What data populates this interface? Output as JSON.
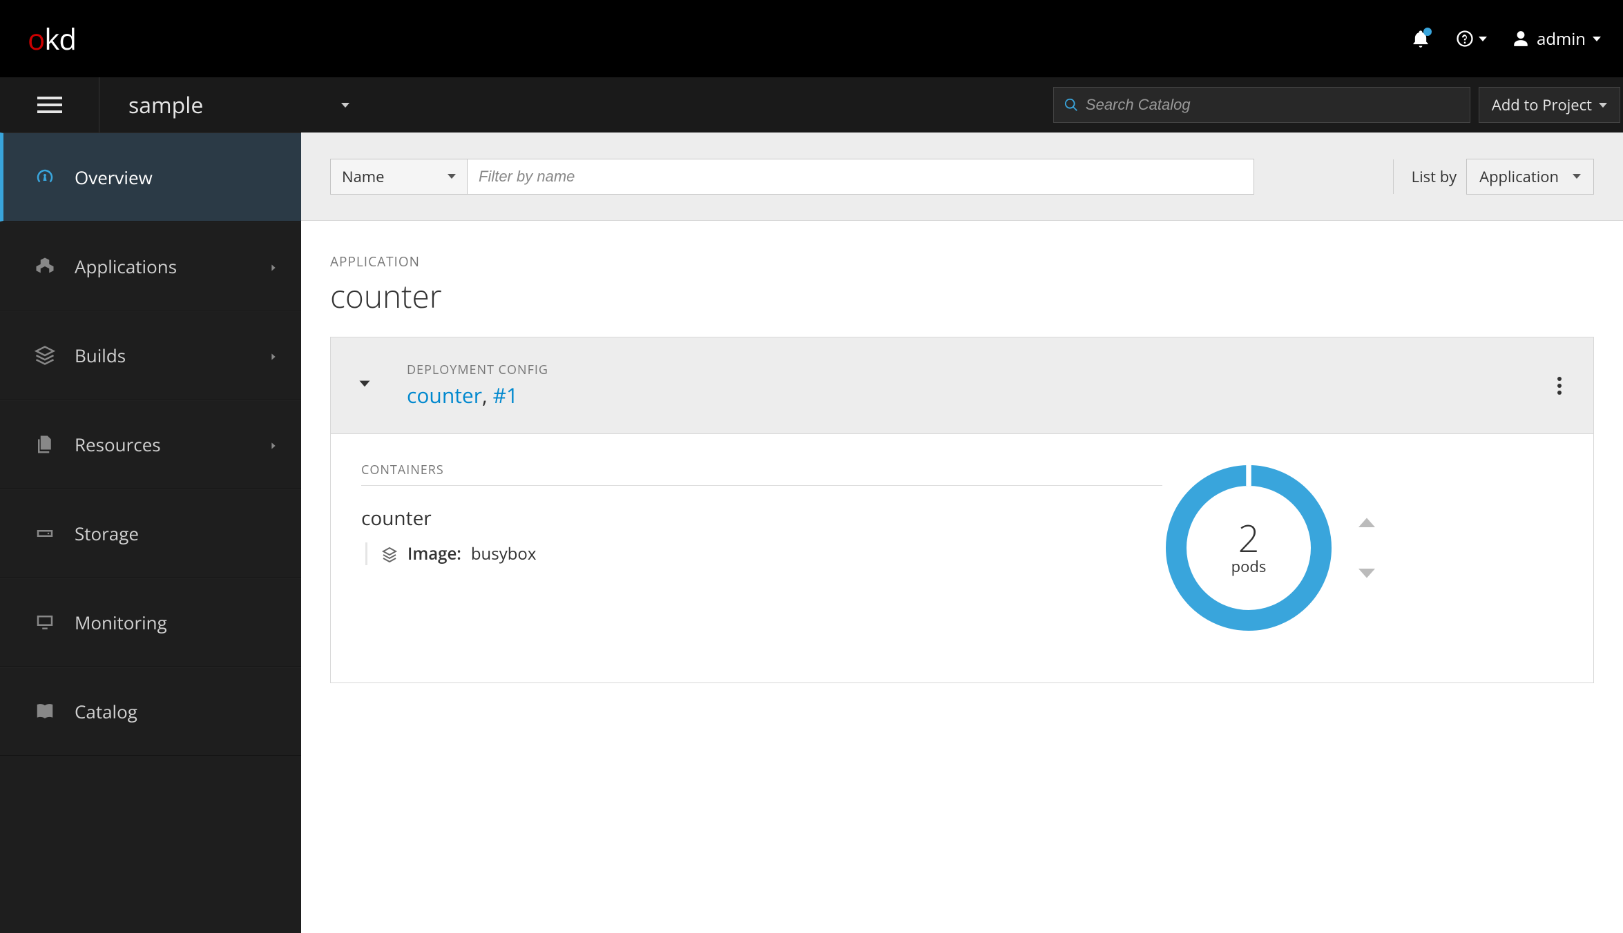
{
  "header": {
    "logo": {
      "o": "o",
      "kd": "kd"
    },
    "username": "admin"
  },
  "project_bar": {
    "project_name": "sample",
    "search_placeholder": "Search Catalog",
    "add_to_project": "Add to Project"
  },
  "sidebar": {
    "items": {
      "overview": "Overview",
      "applications": "Applications",
      "builds": "Builds",
      "resources": "Resources",
      "storage": "Storage",
      "monitoring": "Monitoring",
      "catalog": "Catalog"
    }
  },
  "toolbar": {
    "filter_type": "Name",
    "filter_placeholder": "Filter by name",
    "listby_label": "List by",
    "listby_value": "Application"
  },
  "app": {
    "kicker": "APPLICATION",
    "name": "counter"
  },
  "deployment": {
    "kicker": "DEPLOYMENT CONFIG",
    "name": "counter",
    "version": "#1",
    "containers_heading": "CONTAINERS",
    "container_name": "counter",
    "image_label": "Image:",
    "image_value": "busybox",
    "pod_count": "2",
    "pod_label": "pods"
  },
  "colors": {
    "accent": "#39a5dc",
    "link": "#0088ce",
    "brand_red": "#cc0000"
  }
}
